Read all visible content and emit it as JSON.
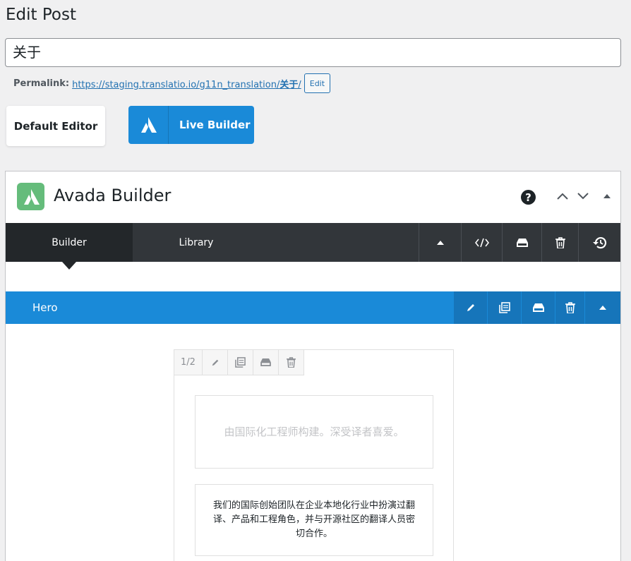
{
  "page": {
    "title": "Edit Post"
  },
  "post": {
    "title_value": "关于"
  },
  "permalink": {
    "label": "Permalink:",
    "url_base": "https://staging.translatio.io/g11n_translation/",
    "url_slug": "关于",
    "url_trail": "/",
    "edit_label": "Edit"
  },
  "editor_switch": {
    "default_label": "Default Editor",
    "live_label": "Live Builder"
  },
  "builder": {
    "title": "Avada Builder",
    "help_symbol": "?",
    "tabs": [
      {
        "label": "Builder",
        "active": true
      },
      {
        "label": "Library",
        "active": false
      }
    ],
    "toolbar_icons": [
      "collapse-icon",
      "code-icon",
      "save-icon",
      "trash-icon",
      "history-icon"
    ]
  },
  "container": {
    "name": "Hero",
    "toolbar_icons": [
      "edit-icon",
      "clone-icon",
      "save-icon",
      "trash-icon",
      "collapse-icon"
    ]
  },
  "column": {
    "size": "1/2",
    "toolbar_icons": [
      "edit-icon",
      "clone-icon",
      "save-icon",
      "trash-icon"
    ],
    "elements": [
      {
        "text": "由国际化工程师构建。深受译者喜爱。",
        "faded": true
      },
      {
        "text": "我们的国际创始团队在企业本地化行业中扮演过翻译、产品和工程角色，并与开源社区的翻译人员密切合作。",
        "faded": false
      }
    ]
  },
  "colors": {
    "accent_blue": "#1a8ad8",
    "dark_bar": "#32363a",
    "avada_green": "#65bc7b"
  }
}
